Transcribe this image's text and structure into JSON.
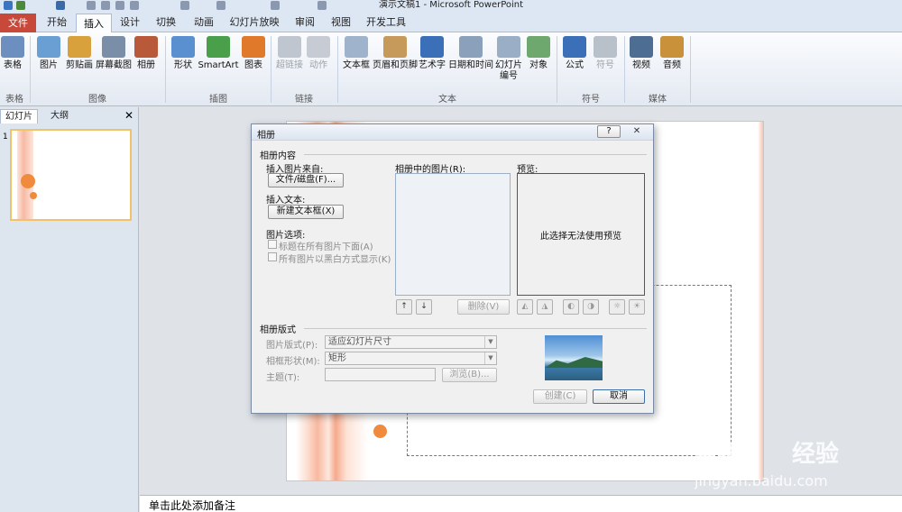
{
  "app": {
    "title": "演示文稿1 - Microsoft PowerPoint"
  },
  "tabs": {
    "file": "文件",
    "home": "开始",
    "insert": "插入",
    "design": "设计",
    "transitions": "切换",
    "animations": "动画",
    "slideshow": "幻灯片放映",
    "review": "审阅",
    "view": "视图",
    "developer": "开发工具"
  },
  "ribbon": {
    "table": "表格",
    "picture": "图片",
    "clipart": "剪贴画",
    "screenshot": "屏幕截图",
    "album": "相册",
    "shapes": "形状",
    "smartart": "SmartArt",
    "chart": "图表",
    "hyperlink": "超链接",
    "action": "动作",
    "textbox": "文本框",
    "headerfooter": "页眉和页脚",
    "wordart": "艺术字",
    "datetime": "日期和时间",
    "slidenum_line1": "幻灯片",
    "slidenum_line2": "编号",
    "object": "对象",
    "equation": "公式",
    "symbol": "符号",
    "video": "视频",
    "audio": "音频",
    "groups": {
      "tables": "表格",
      "images": "图像",
      "illustrations": "插图",
      "links": "链接",
      "text": "文本",
      "symbols": "符号",
      "media": "媒体"
    }
  },
  "left_panel": {
    "slides_tab": "幻灯片",
    "outline_tab": "大纲",
    "slide_number": "1"
  },
  "notes_placeholder": "单击此处添加备注",
  "dialog": {
    "title": "相册",
    "help_glyph": "?",
    "close_glyph": "✕",
    "content_section": "相册内容",
    "insert_from": "插入图片来自:",
    "file_disk_btn": "文件/磁盘(F)...",
    "insert_text": "插入文本:",
    "new_textbox_btn": "新建文本框(X)",
    "picture_options": "图片选项:",
    "caption_below": "标题在所有图片下面(A)",
    "all_black_white": "所有图片以黑白方式显示(K)",
    "pictures_in_album": "相册中的图片(R):",
    "preview_label": "预览:",
    "preview_message": "此选择无法使用预览",
    "move_up": "↑",
    "move_down": "↓",
    "remove_btn": "删除(V)",
    "layout_section": "相册版式",
    "picture_layout_label": "图片版式(P):",
    "picture_layout_value": "适应幻灯片尺寸",
    "frame_shape_label": "相框形状(M):",
    "frame_shape_value": "矩形",
    "theme_label": "主题(T):",
    "browse_btn": "浏览(B)...",
    "create_btn": "创建(C)",
    "cancel_btn": "取消"
  },
  "watermark": {
    "brand": "Bai",
    "brand2": "经验",
    "url": "jingyan.baidu.com"
  },
  "colors": {
    "file_tab": "#c8483a",
    "accent_orange": "#f08a3c",
    "ribbon_bg": "#e3e9f2"
  }
}
